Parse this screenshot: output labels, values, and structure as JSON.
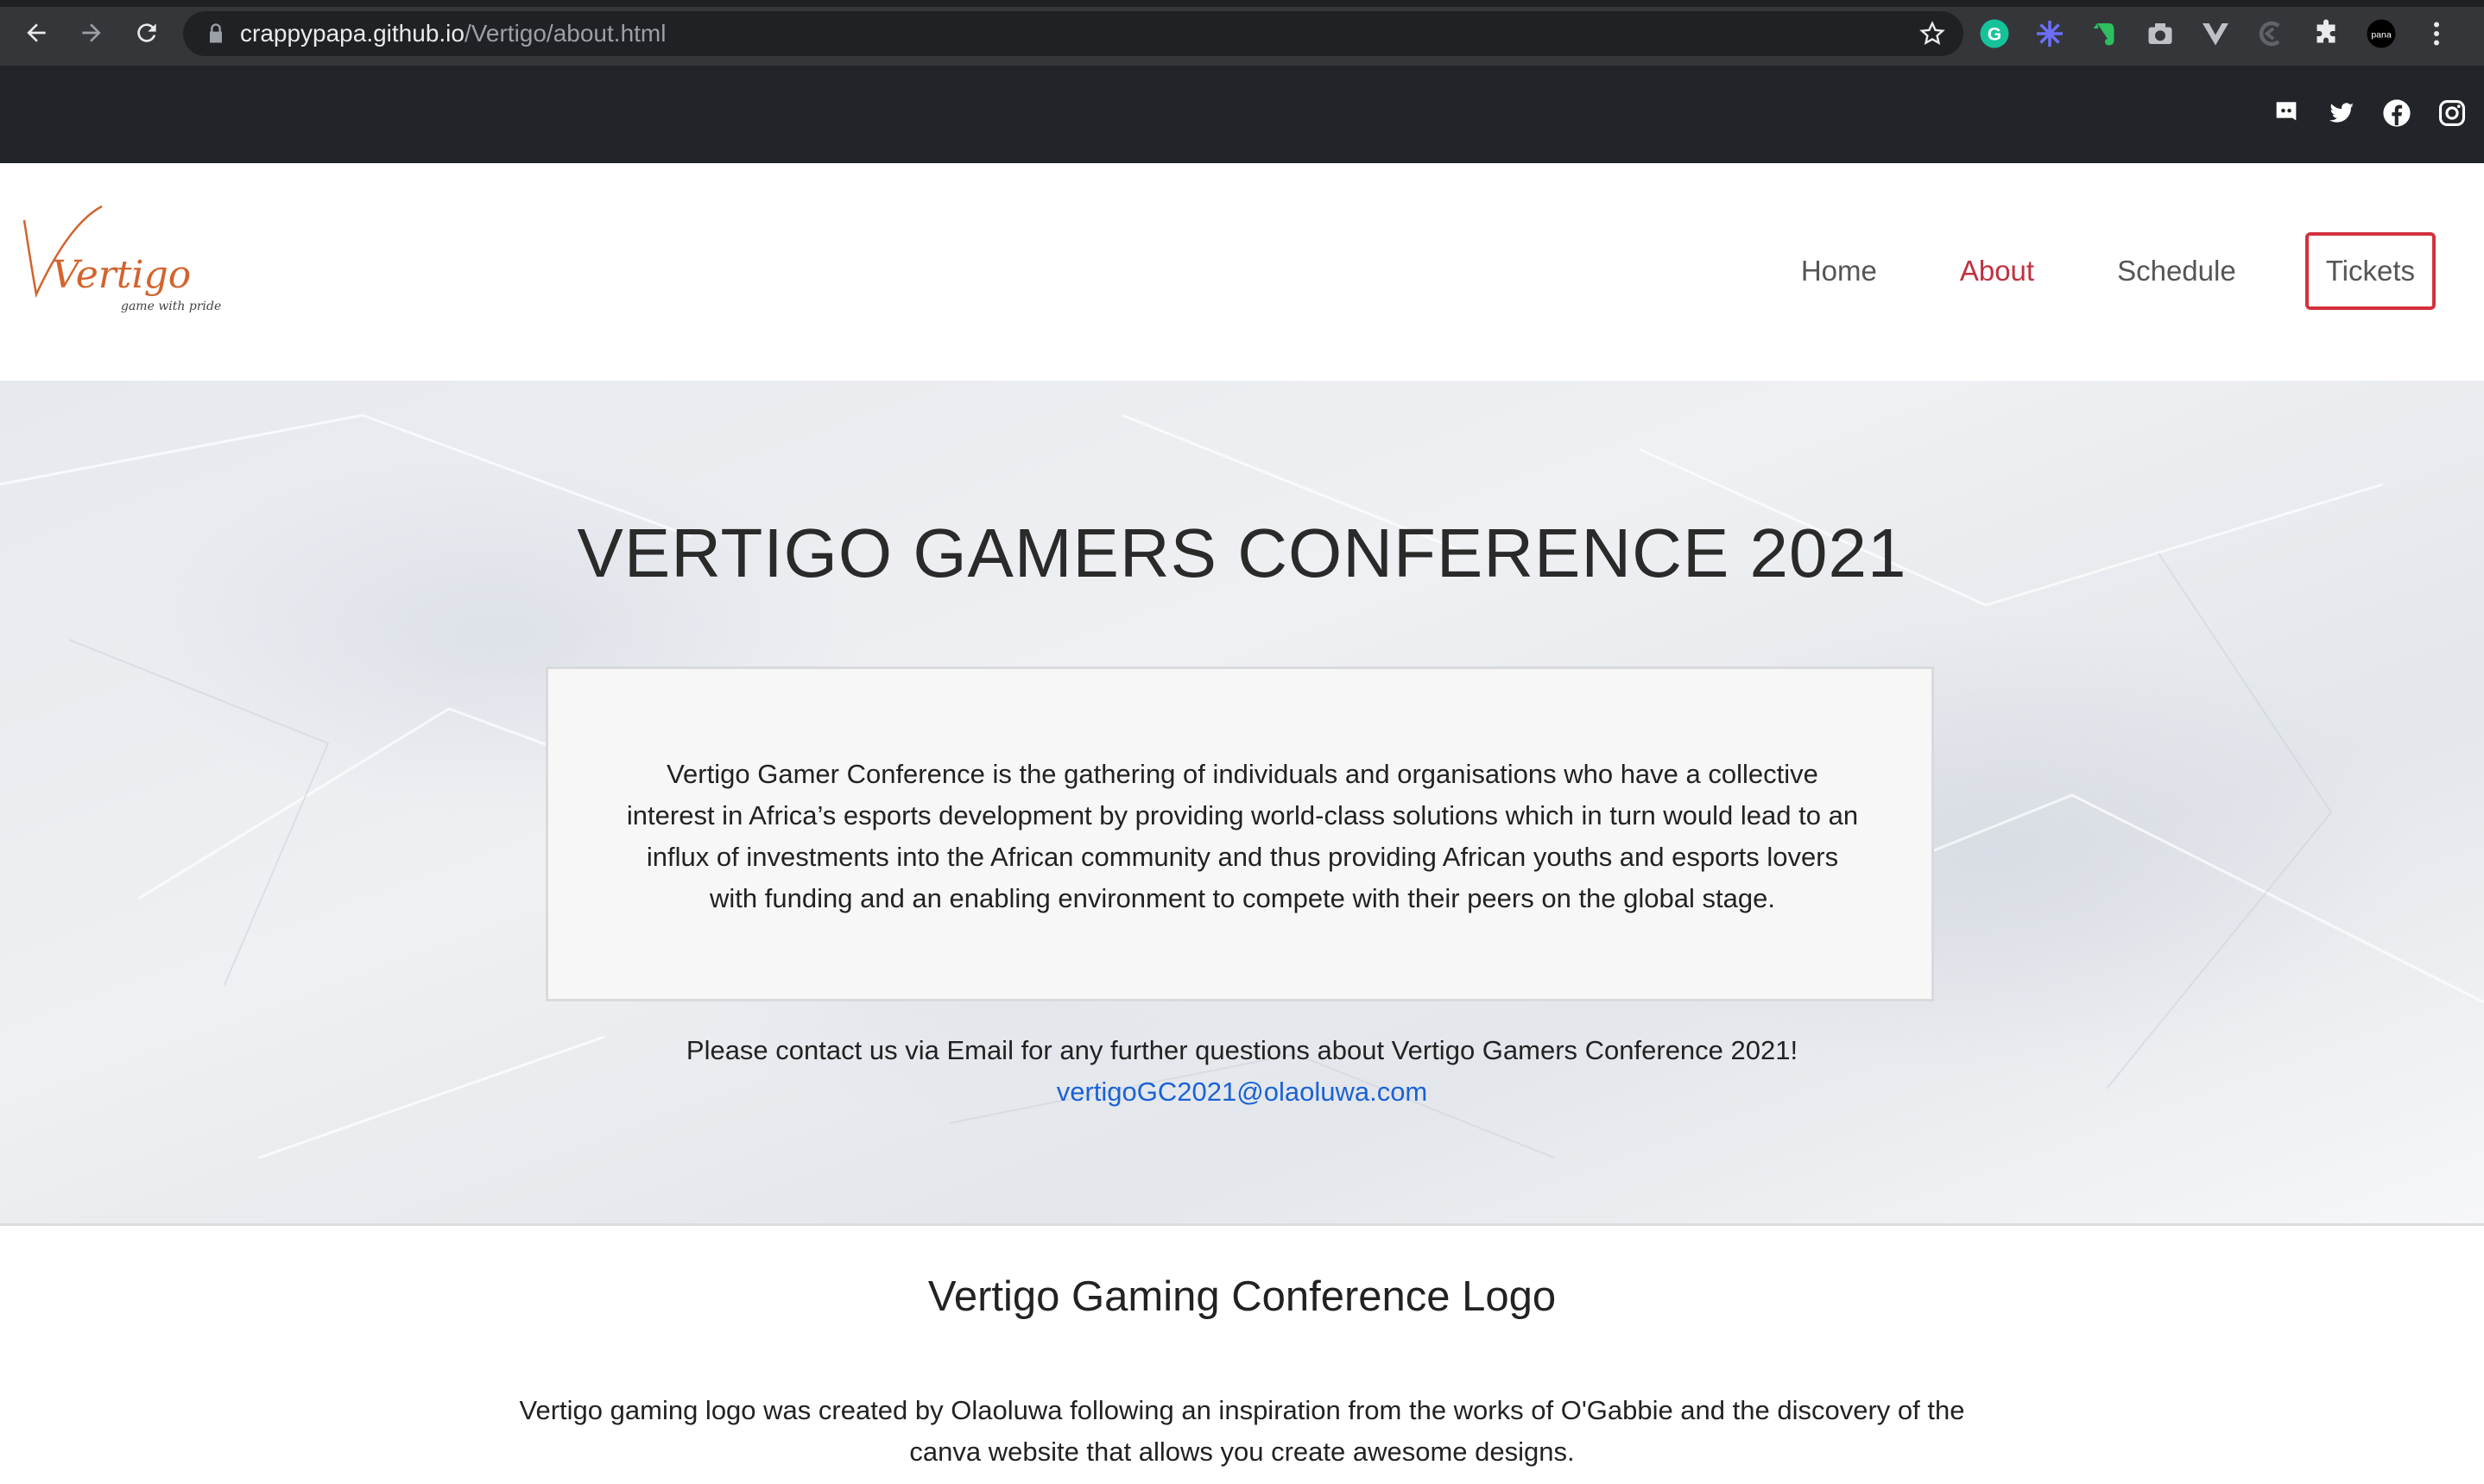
{
  "browser": {
    "url_host": "crappypapa.github.io",
    "url_path": "/Vertigo/about.html",
    "icons": [
      "back-arrow-icon",
      "forward-arrow-icon",
      "reload-icon",
      "lock-icon",
      "bookmark-star-icon",
      "grammarly-icon",
      "extension-icon",
      "evernote-icon",
      "camera-icon",
      "vue-devtools-icon",
      "extension-icon",
      "puzzle-icon",
      "profile-avatar",
      "menu-kebab-icon"
    ],
    "avatar_text": "pana"
  },
  "socials": [
    "discord-icon",
    "twitter-icon",
    "facebook-icon",
    "instagram-icon"
  ],
  "header": {
    "logo_text": "Vertigo",
    "logo_tagline": "game with pride",
    "nav": {
      "home": "Home",
      "about": "About",
      "schedule": "Schedule",
      "tickets": "Tickets"
    },
    "active_color": "#c0313f"
  },
  "hero": {
    "title": "VERTIGO GAMERS CONFERENCE 2021",
    "about_text": "Vertigo Gamer Conference is the gathering of individuals and organisations who have a collective interest in Africa’s esports development by providing world-class solutions which in turn would lead to an influx of investments into the African community and thus providing African youths and esports lovers with funding and an enabling environment to compete with their peers on the global stage.",
    "contact_text": "Please contact us via Email for any further questions about Vertigo Gamers Conference 2021!",
    "email": "vertigoGC2021@olaoluwa.com"
  },
  "logo_section": {
    "heading": "Vertigo Gaming Conference Logo",
    "description": "Vertigo gaming logo was created by Olaoluwa following an inspiration from the works of O'Gabbie and the discovery of the canva website that allows you create awesome designs."
  }
}
